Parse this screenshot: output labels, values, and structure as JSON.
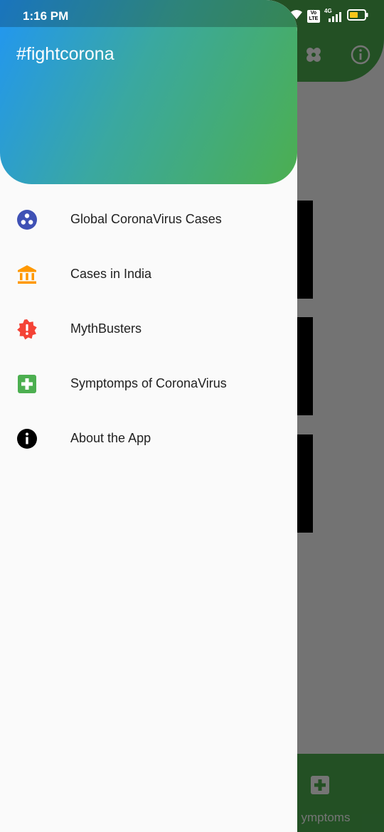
{
  "status_bar": {
    "time": "1:16 PM",
    "network": "4G",
    "volte_badge": "Vo LTE",
    "icons": [
      "wifi-icon",
      "volte-icon",
      "signal-icon",
      "battery-icon"
    ]
  },
  "drawer": {
    "title": "#fightcorona",
    "items": [
      {
        "label": "Global CoronaVirus Cases",
        "icon": "globe-dots-icon",
        "color": "#3f51b5"
      },
      {
        "label": "Cases in India",
        "icon": "bank-icon",
        "color": "#ff9800"
      },
      {
        "label": "MythBusters",
        "icon": "alert-badge-icon",
        "color": "#f44336"
      },
      {
        "label": "Symptomps of CoronaVirus",
        "icon": "medical-plus-icon",
        "color": "#4caf50"
      },
      {
        "label": "About the App",
        "icon": "info-icon",
        "color": "#000000"
      }
    ]
  },
  "background_app": {
    "appbar_actions": [
      "bandage-icon",
      "info-outline-icon"
    ],
    "bottom_nav_label": "ymptoms",
    "colors": {
      "primary": "#4caf50",
      "header_gradient_start": "#2196f3",
      "header_gradient_end": "#4caf50"
    }
  }
}
